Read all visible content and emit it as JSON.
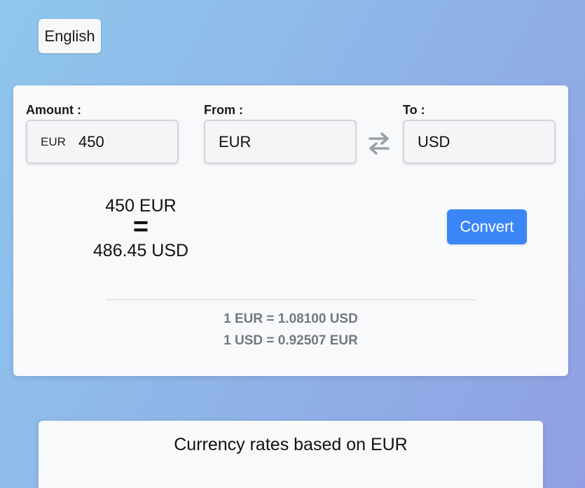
{
  "language": {
    "label": "English"
  },
  "converter": {
    "amount": {
      "label": "Amount :",
      "currency_prefix": "EUR",
      "value": "450"
    },
    "from": {
      "label": "From :",
      "value": "EUR"
    },
    "swap_icon": "swap-arrows-icon",
    "to": {
      "label": "To :",
      "value": "USD"
    },
    "result": {
      "from_text": "450 EUR",
      "equals": "=",
      "to_text": "486.45 USD"
    },
    "convert_label": "Convert",
    "rates": [
      "1 EUR = 1.08100 USD",
      "1 USD = 0.92507 EUR"
    ],
    "accent_color": "#3b86f6"
  },
  "rates_panel": {
    "title": "Currency rates based on EUR"
  }
}
